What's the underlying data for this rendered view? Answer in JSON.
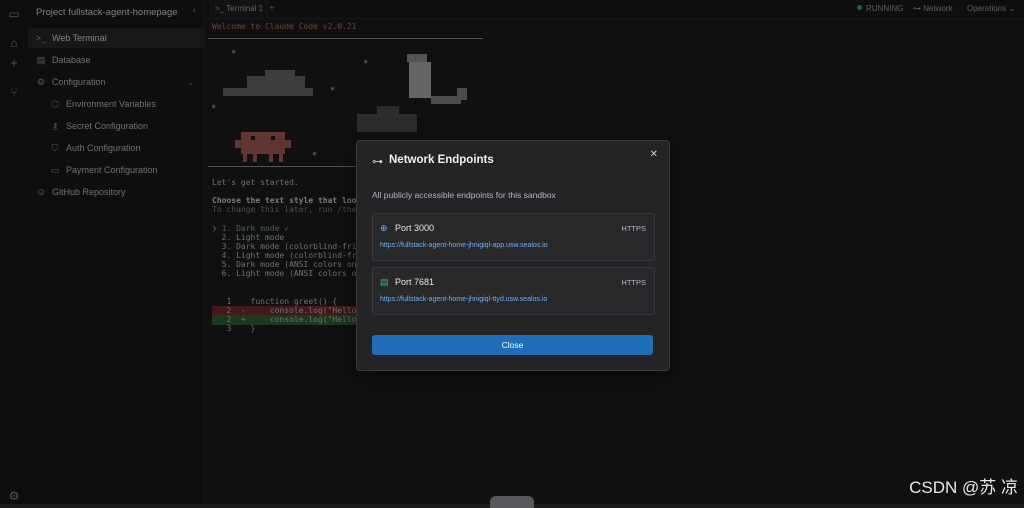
{
  "sidebar": {
    "project": "Project fullstack-agent-homepage",
    "items": [
      {
        "label": "Web Terminal",
        "icon": "terminal-icon"
      },
      {
        "label": "Database",
        "icon": "database-icon"
      },
      {
        "label": "Configuration",
        "icon": "gear-icon"
      },
      {
        "label": "Environment Variables",
        "icon": "cube-icon"
      },
      {
        "label": "Secret Configuration",
        "icon": "key-icon"
      },
      {
        "label": "Auth Configuration",
        "icon": "shield-icon"
      },
      {
        "label": "Payment Configuration",
        "icon": "card-icon"
      },
      {
        "label": "GitHub Repository",
        "icon": "github-icon"
      }
    ]
  },
  "tabbar": {
    "tab": "Terminal 1",
    "add": "+",
    "status": "RUNNING",
    "network": "Network",
    "operations": "Operations"
  },
  "terminal": {
    "welcome": "Welcome to Claude Code v2.0.21",
    "started": "Let's get started.",
    "choose": "Choose the text style that look",
    "change": "To change this later, run /them",
    "options": [
      "❯ 1. Dark mode ✓",
      "  2. Light mode",
      "  3. Dark mode (colorblind-frie",
      "  4. Light mode (colorblind-fri",
      "  5. Dark mode (ANSI colors on",
      "  6. Light mode (ANSI colors on"
    ],
    "code": [
      "   1    function greet() {",
      "   2  -     console.log(\"Hello, Wo",
      "   2  +     console.log(\"Hello, Cl",
      "   3    }"
    ]
  },
  "modal": {
    "title": "Network Endpoints",
    "subtitle": "All publicly accessible endpoints for this sandbox",
    "endpoints": [
      {
        "port": "Port 3000",
        "protocol": "HTTPS",
        "url": "https://fullstack-agent-home-jhnigiql-app.usw.sealos.io",
        "icon": "globe-icon"
      },
      {
        "port": "Port 7681",
        "protocol": "HTTPS",
        "url": "https://fullstack-agent-home-jhnigiql-ttyd.usw.sealos.io",
        "icon": "server-icon"
      }
    ],
    "close": "Close"
  },
  "watermark": "CSDN @苏 凉",
  "colors": {
    "accent": "#1e6fb8",
    "running": "#22c55e",
    "link": "#6cb2ff"
  }
}
